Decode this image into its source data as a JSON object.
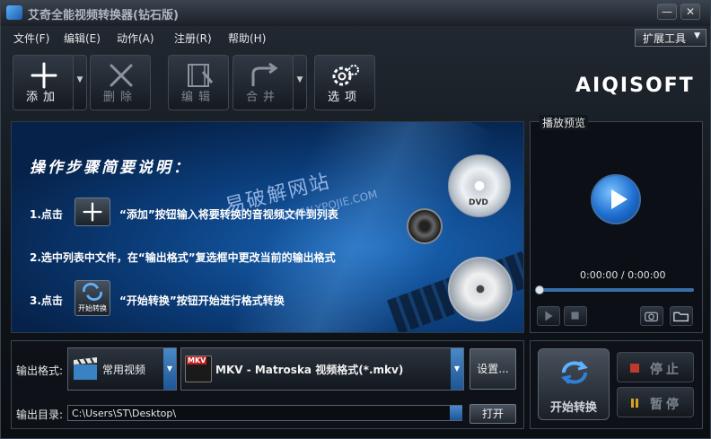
{
  "window": {
    "title": "艾奇全能视频转换器(钻石版)",
    "minimize": "—",
    "close": "✕"
  },
  "menu": {
    "items": [
      "文件(F)",
      "编辑(E)",
      "动作(A)",
      "注册(R)",
      "帮助(H)"
    ],
    "extension_tools": "扩展工具"
  },
  "toolbar": {
    "add": "添加",
    "delete": "删除",
    "edit": "编辑",
    "merge": "合并",
    "options": "选项"
  },
  "brand": {
    "logo": "AIQISOFT"
  },
  "guide": {
    "title": "操作步骤简要说明：",
    "step1_prefix": "1.点击",
    "step1_text": "“添加”按钮输入将要转换的音视频文件到列表",
    "step2_text": "2.选中列表中文件，在“输出格式”复选框中更改当前的输出格式",
    "step3_prefix": "3.点击",
    "step3_text": "“开始转换”按钮开始进行格式转换",
    "step3_icon_label": "开始转换",
    "watermark": "易破解网站",
    "watermark_url": "WWW.YPOJIE.COM",
    "dvd_label": "DVD"
  },
  "preview": {
    "legend": "播放预览",
    "time": "0:00:00 / 0:00:00",
    "progress": 0
  },
  "output": {
    "format_label": "输出格式:",
    "category": "常用视频",
    "format": "MKV - Matroska 视频格式(*.mkv)",
    "format_icon_text": "MKV",
    "settings_button": "设置...",
    "dir_label": "输出目录:",
    "dir_value": "C:\\Users\\ST\\Desktop\\",
    "open_button": "打开"
  },
  "convert": {
    "start": "开始转换",
    "stop": "停止",
    "pause": "暂停"
  },
  "colors": {
    "accent": "#1f6fd1",
    "disabled_text": "#7d8691",
    "stop_mark": "#c0392b",
    "pause_mark": "#d9a21b"
  }
}
